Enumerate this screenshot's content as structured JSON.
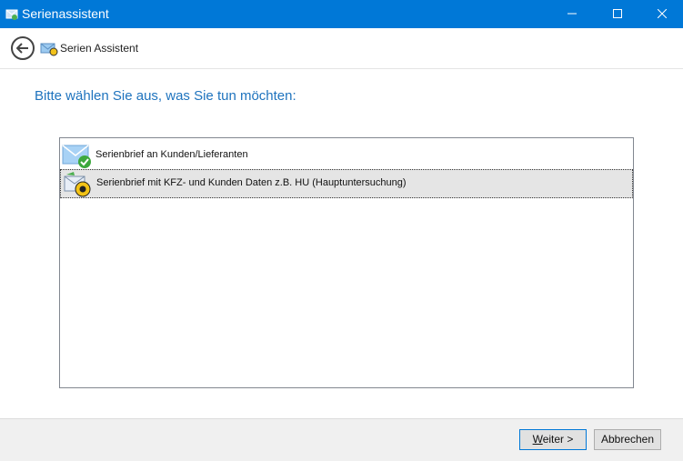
{
  "window": {
    "title": "Serienassistent",
    "accent_color": "#0078d7"
  },
  "header": {
    "title": "Serien Assistent"
  },
  "prompt": "Bitte wählen Sie aus, was Sie tun möchten:",
  "options": [
    {
      "label": "Serienbrief an Kunden/Lieferanten",
      "icon": "mail-check-icon",
      "selected": false
    },
    {
      "label": "Serienbrief mit KFZ- und Kunden Daten z.B. HU (Hauptuntersuchung)",
      "icon": "mail-inspection-badge-icon",
      "selected": true
    }
  ],
  "footer": {
    "next_prefix": "W",
    "next_rest": "eiter >",
    "cancel_label": "Abbrechen"
  }
}
